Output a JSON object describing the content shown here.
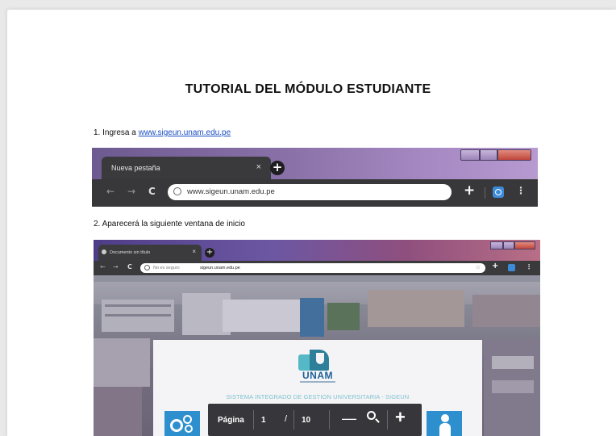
{
  "document": {
    "title": "TUTORIAL DEL MÓDULO ESTUDIANTE",
    "step1": {
      "number": "1.",
      "text": "Ingresa a",
      "link": "www.sigeun.unam.edu.pe"
    },
    "step2": {
      "number": "2.",
      "text": "Aparecerá la siguiente ventana de inicio"
    }
  },
  "browser_figure": {
    "tab_title": "Nueva pestaña",
    "tab_close": "×",
    "new_tab": "+",
    "back": "←",
    "forward": "→",
    "reload": "C",
    "address": "www.sigeun.unam.edu.pe",
    "add": "+",
    "menu": "⋮"
  },
  "screenshot_figure": {
    "tab_title": "Documento sin título",
    "tab_close": "×",
    "new_tab": "+",
    "back": "←",
    "forward": "→",
    "reload": "C",
    "security": "No es seguro",
    "address": "sigeun.unam.edu.pe",
    "star": "☆",
    "add": "+",
    "menu": "⋮",
    "logo_text": "UNAM",
    "system_name": "SISTEMA INTEGRADO DE GESTION UNIVERSITARIA - SIGEUN",
    "pdf_toolbar": {
      "page_label": "Página",
      "current_page": "1",
      "separator": "/",
      "total_pages": "10",
      "zoom_out": "—",
      "zoom_in": "+"
    }
  },
  "colors": {
    "link": "#1a4fc4",
    "tile_blue": "#2e8fcf",
    "system_text": "#7fc2d0",
    "logo_blue": "#1c5f9a"
  }
}
